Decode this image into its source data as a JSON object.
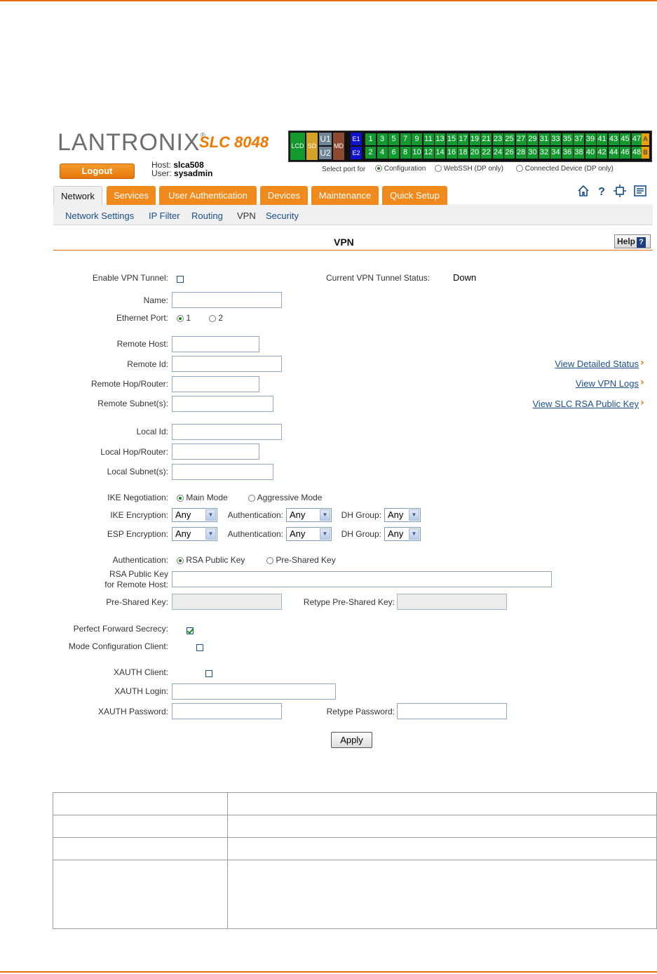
{
  "header": {
    "brand": "LANTRONIX",
    "registered": "®",
    "model": "SLC 8048",
    "logout_label": "Logout",
    "host_label": "Host:",
    "host_value": "slca508",
    "user_label": "User:",
    "user_value": "sysadmin"
  },
  "port_panel": {
    "lcd": "LCD",
    "sd": "SD",
    "u1": "U1",
    "u2": "U2",
    "md": "MD",
    "e1": "E1",
    "e2": "E2",
    "odd_ports": [
      "1",
      "3",
      "5",
      "7",
      "9",
      "11",
      "13",
      "15",
      "17",
      "19",
      "21",
      "23",
      "25",
      "27",
      "29",
      "31",
      "33",
      "35",
      "37",
      "39",
      "41",
      "43",
      "45",
      "47"
    ],
    "even_ports": [
      "2",
      "4",
      "6",
      "8",
      "10",
      "12",
      "14",
      "16",
      "18",
      "20",
      "22",
      "24",
      "26",
      "28",
      "30",
      "32",
      "34",
      "36",
      "38",
      "40",
      "42",
      "44",
      "46",
      "48"
    ],
    "a": "A",
    "b": "B",
    "select_label": "Select port for",
    "opt_configuration": "Configuration",
    "opt_webssh": "WebSSH (DP only)",
    "opt_connected": "Connected Device (DP only)"
  },
  "tabs": [
    "Network",
    "Services",
    "User Authentication",
    "Devices",
    "Maintenance",
    "Quick Setup"
  ],
  "subnav": [
    "Network Settings",
    "IP Filter",
    "Routing",
    "VPN",
    "Security"
  ],
  "page": {
    "title": "VPN",
    "help": "Help",
    "help_q": "?"
  },
  "form": {
    "enable_vpn_tunnel": "Enable VPN Tunnel:",
    "current_status_label": "Current VPN Tunnel Status:",
    "current_status_value": "Down",
    "name": "Name:",
    "ethernet_port": "Ethernet Port:",
    "eth_opt1": "1",
    "eth_opt2": "2",
    "remote_host": "Remote Host:",
    "remote_id": "Remote Id:",
    "remote_hop": "Remote Hop/Router:",
    "remote_subnet": "Remote Subnet(s):",
    "local_id": "Local Id:",
    "local_hop": "Local Hop/Router:",
    "local_subnet": "Local Subnet(s):",
    "ike_negotiation": "IKE Negotiation:",
    "main_mode": "Main Mode",
    "aggressive_mode": "Aggressive Mode",
    "ike_encryption": "IKE Encryption:",
    "esp_encryption": "ESP Encryption:",
    "authentication_inline": "Authentication:",
    "dh_group": "DH Group:",
    "select_any": "Any",
    "authentication": "Authentication:",
    "rsa_public_key_opt": "RSA Public Key",
    "pre_shared_key_opt": "Pre-Shared Key",
    "rsa_key_line1": "RSA Public Key",
    "rsa_key_line2": "for Remote Host:",
    "pre_shared_key": "Pre-Shared Key:",
    "retype_pre_shared_key": "Retype Pre-Shared Key:",
    "perfect_forward_secrecy": "Perfect Forward Secrecy:",
    "mode_configuration_client": "Mode Configuration Client:",
    "xauth_client": "XAUTH Client:",
    "xauth_login": "XAUTH Login:",
    "xauth_password": "XAUTH Password:",
    "retype_password": "Retype Password:",
    "apply": "Apply"
  },
  "links": {
    "view_detailed_status": "View Detailed Status",
    "view_vpn_logs": "View VPN Logs",
    "view_rsa_key": "View SLC RSA Public Key",
    "chevron": "›"
  },
  "colors": {
    "accent": "#e46c0a",
    "tab": "#f18a1c",
    "link": "#1b4f8c",
    "port_green": "#139a2f"
  }
}
